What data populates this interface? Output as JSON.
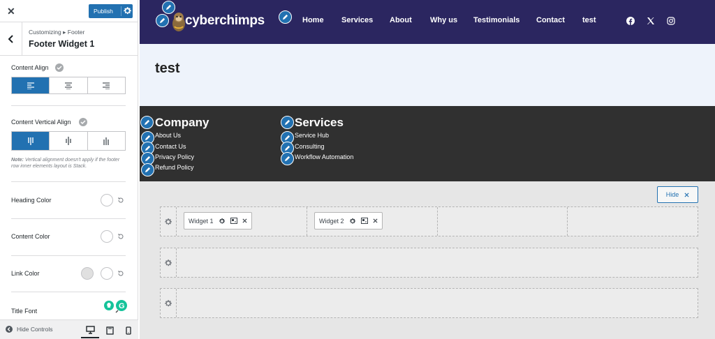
{
  "panel": {
    "close_label": "✕",
    "publish_label": "Publish",
    "breadcrumb": "Customizing ▸ Footer",
    "title": "Footer Widget 1",
    "content_align_label": "Content Align",
    "content_vertical_align_label": "Content Vertical Align",
    "vertical_note_bold": "Note:",
    "vertical_note": " Vertical alignment doesn't apply if the footer row inner elements layout is Stack.",
    "heading_color_label": "Heading Color",
    "content_color_label": "Content Color",
    "link_color_label": "Link Color",
    "title_font_label": "Title Font",
    "hide_controls_label": "Hide Controls",
    "accent_color": "#2271b1"
  },
  "site": {
    "logo_text": "cyberchimps",
    "nav": [
      "Home",
      "Services",
      "About",
      "Why us",
      "Testimonials",
      "Contact",
      "test"
    ],
    "header_bg": "#2b2660",
    "hero_title": "test",
    "footer": {
      "col1": {
        "heading": "Company",
        "links": [
          "About Us",
          "Contact Us",
          "Privacy Policy",
          "Refund Policy"
        ]
      },
      "col2": {
        "heading": "Services",
        "links": [
          "Service Hub",
          "Consulting",
          "Workflow Automation"
        ]
      }
    }
  },
  "builder": {
    "hide_label": "Hide",
    "widgets": [
      "Widget 1",
      "Widget 2"
    ]
  }
}
